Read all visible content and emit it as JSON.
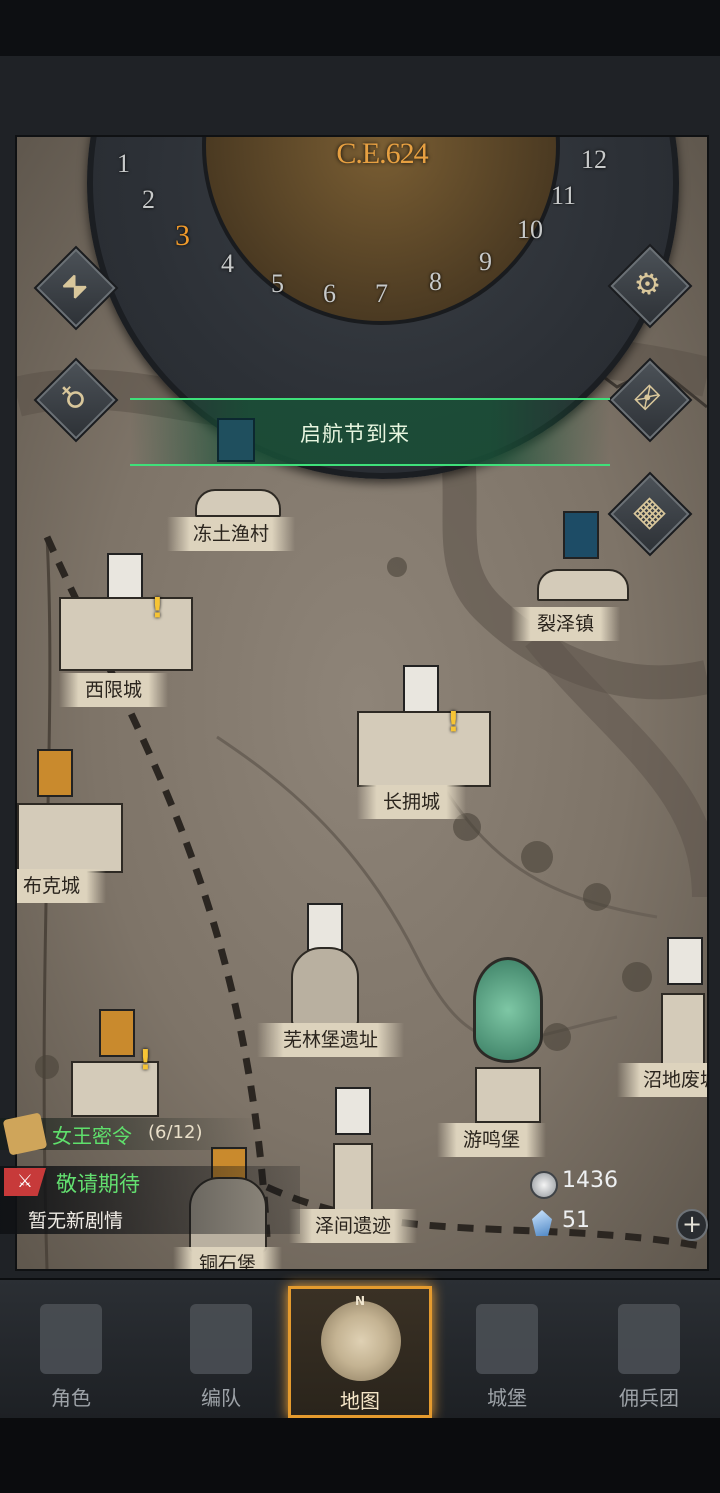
{
  "calendar": {
    "year": "C.E.624",
    "months": [
      "1",
      "2",
      "3",
      "4",
      "5",
      "6",
      "7",
      "8",
      "9",
      "10",
      "11",
      "12"
    ],
    "current_month": "3"
  },
  "event_banner": {
    "text": "启航节到来"
  },
  "places": {
    "frozen_village": "冻土渔村",
    "west_city": "西限城",
    "rift_town": "裂泽镇",
    "changyong_city": "长拥城",
    "buke_city": "布克城",
    "wulin_ruins": "芜林堡遗址",
    "youming_fort": "游鸣堡",
    "zejian_ruins": "泽间遗迹",
    "swamp_ruins": "沼地废墟",
    "hidden_fort": "铜石堡"
  },
  "quest": {
    "title": "女王密令",
    "progress": "(6/12)"
  },
  "story": {
    "title": "敬请期待",
    "subtitle": "暂无新剧情"
  },
  "currency": {
    "silver": "1436",
    "crystal": "51"
  },
  "nav": {
    "items": [
      "角色",
      "编队",
      "地图",
      "城堡",
      "佣兵团"
    ],
    "active": "地图",
    "compass_letter": "N"
  },
  "colors": {
    "accent": "#e59b2e",
    "quest_green": "#5fe06c",
    "year_orange": "#e7a041"
  }
}
